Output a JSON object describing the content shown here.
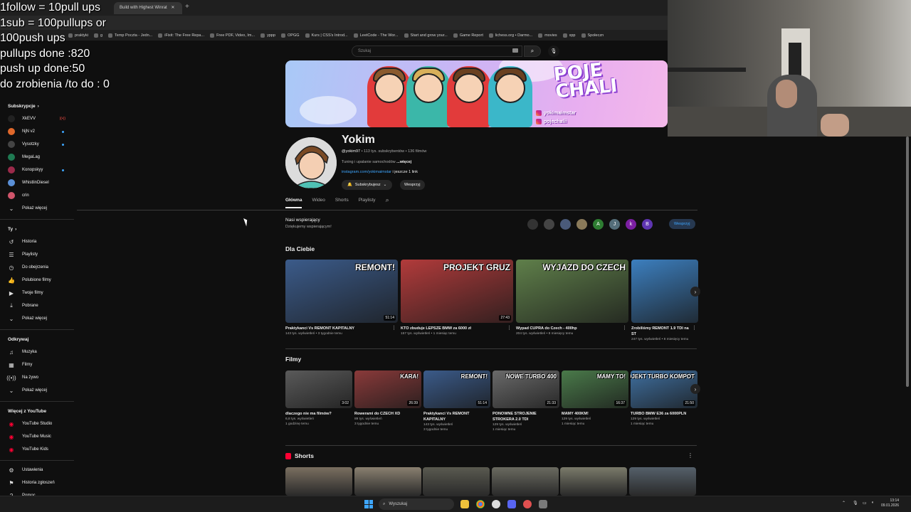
{
  "overlay": {
    "lines": [
      "1follow = 10pull ups",
      "1sub = 100pullups or",
      "100push ups",
      "pullups done :820",
      "push up done:50",
      "do zrobienia /to do : 0"
    ]
  },
  "browser": {
    "tabs": [
      "Build with Highest Winrat"
    ],
    "new_tab_glyph": "+",
    "bookmarks": [
      "praktyki",
      "g",
      "Temp Poczta - Jedn...",
      "iFixit: The Free Repa...",
      "Free PDF, Video, Im...",
      "yppp",
      "OPGG",
      "Kurs | CSS's Introd...",
      "LeetCode - The Wor...",
      "Start and grow your...",
      "Game Report",
      "lichess.org • Darmo...",
      "movies",
      "xpp",
      "Społeczn"
    ]
  },
  "header": {
    "search_placeholder": "Szukaj"
  },
  "sidebar": {
    "subs_title": "Subskrypcje",
    "subs": [
      {
        "label": "XkEVV",
        "color": "#222222",
        "badge": "live"
      },
      {
        "label": "NjN v2",
        "color": "#e0682b",
        "badge": "dot"
      },
      {
        "label": "Vysotzky",
        "color": "#444444",
        "badge": "dot"
      },
      {
        "label": "MegaLag",
        "color": "#1f7a52",
        "badge": ""
      },
      {
        "label": "Konopskyy",
        "color": "#9b2a4a",
        "badge": "dot"
      },
      {
        "label": "WhistlinDiesel",
        "color": "#5a8fd6",
        "badge": ""
      },
      {
        "label": "crin",
        "color": "#d0556b",
        "badge": ""
      }
    ],
    "show_more": "Pokaż więcej",
    "you_title": "Ty",
    "you_items": [
      {
        "label": "Historia",
        "icon": "history-icon",
        "glyph": "↺"
      },
      {
        "label": "Playlisty",
        "icon": "playlists-icon",
        "glyph": "☰"
      },
      {
        "label": "Do obejrzenia",
        "icon": "watch-later-icon",
        "glyph": "◷"
      },
      {
        "label": "Polubione filmy",
        "icon": "liked-icon",
        "glyph": "👍"
      },
      {
        "label": "Twoje filmy",
        "icon": "your-videos-icon",
        "glyph": "▶"
      },
      {
        "label": "Pobrane",
        "icon": "downloads-icon",
        "glyph": "⤓"
      },
      {
        "label": "Pokaż więcej",
        "icon": "chevron-down-icon",
        "glyph": "⌄"
      }
    ],
    "explore_title": "Odkrywaj",
    "explore_items": [
      {
        "label": "Muzyka",
        "icon": "music-icon",
        "glyph": "♫"
      },
      {
        "label": "Filmy",
        "icon": "movies-icon",
        "glyph": "▦"
      },
      {
        "label": "Na żywo",
        "icon": "live-icon",
        "glyph": "((•))"
      },
      {
        "label": "Pokaż więcej",
        "icon": "chevron-down-icon",
        "glyph": "⌄"
      }
    ],
    "more_title": "Więcej z YouTube",
    "more_items": [
      "YouTube Studio",
      "YouTube Music",
      "YouTube Kids"
    ],
    "bottom_items": [
      {
        "label": "Ustawienia",
        "icon": "settings-icon",
        "glyph": "⚙"
      },
      {
        "label": "Historia zgłoszeń",
        "icon": "flag-icon",
        "glyph": "⚑"
      },
      {
        "label": "Pomoc",
        "icon": "help-icon",
        "glyph": "?"
      }
    ]
  },
  "banner": {
    "logo": "POJE\nCHALI",
    "insta_1": "yokimaimstar",
    "insta_2": "pojechalii"
  },
  "channel": {
    "name": "Yokim",
    "handle": "@yokim97",
    "meta": " • 113 tys. subskrybentów • 136 filmów",
    "desc": "Tuning i upalanie samochodów ",
    "desc_more": "...więcej",
    "link": "instagram.com/yokimaimstar",
    "link_more": " i jeszcze 1 link",
    "subscribed_label": "Subskrybujesz",
    "join_label": "Wesprzyj",
    "tabs": [
      "Główna",
      "Wideo",
      "Shorts",
      "Playlisty"
    ]
  },
  "supporters": {
    "title": "Nasi wspierający",
    "subtitle": "Dziękujemy wspierającym!",
    "avatars": [
      {
        "letter": "",
        "color": "#333333"
      },
      {
        "letter": "",
        "color": "#444444"
      },
      {
        "letter": "",
        "color": "#4a5a7a"
      },
      {
        "letter": "",
        "color": "#8a7a5a"
      },
      {
        "letter": "A",
        "color": "#2e7d32"
      },
      {
        "letter": "J",
        "color": "#546e7a"
      },
      {
        "letter": "k",
        "color": "#7b1fa2"
      },
      {
        "letter": "B",
        "color": "#5e35b1"
      }
    ],
    "button": "Wesprzyj"
  },
  "for_you": {
    "title": "Dla Ciebie",
    "videos": [
      {
        "title": "Praktykanci Vs REMONT KAPITALNY",
        "meta": "143 tys. wyświetleń • 3 tygodnie temu",
        "duration": "51:14",
        "overlay": "REMONT!",
        "bg": "#3b5b8a"
      },
      {
        "title": "KTO zbuduje LEPSZE BMW za 6000 zł",
        "meta": "157 tys. wyświetleń • 1 miesiąc temu",
        "duration": "27:43",
        "overlay": "PROJEKT GRUZ",
        "bg": "#b23b3b"
      },
      {
        "title": "Wypad CUPRA do Czech - 400hp",
        "meta": "204 tys. wyświetleń • 8 miesięcy temu",
        "duration": "",
        "overlay": "WYJAZD DO CZECH",
        "bg": "#5f7f4a"
      },
      {
        "title": "Zrobiliśmy REMONT 1.9 TDI na ST",
        "meta": "247 tys. wyświetleń • 8 miesięcy temu",
        "duration": "",
        "overlay": "",
        "bg": "#3c7fbf"
      }
    ]
  },
  "films": {
    "title": "Filmy",
    "videos": [
      {
        "title": "dlaczego nie ma filmów?",
        "meta1": "6,8 tys. wyświetleń",
        "meta2": "1 godzinę temu",
        "duration": "3:02",
        "overlay": "",
        "bg": "#5a5a5a"
      },
      {
        "title": "Rowerami do CZECH XD",
        "meta1": "89 tys. wyświetleń",
        "meta2": "3 tygodnie temu",
        "duration": "26:39",
        "overlay": "KARA!",
        "bg": "#8a3a3a"
      },
      {
        "title": "Praktykanci Vs REMONT KAPITALNY",
        "meta1": "143 tys. wyświetleń",
        "meta2": "3 tygodnie temu",
        "duration": "51:14",
        "overlay": "REMONT!",
        "bg": "#3b5b8a"
      },
      {
        "title": "PONOWNE STROJENIE STROKERA 2.0 TDI",
        "meta1": "129 tys. wyświetleń",
        "meta2": "1 miesiąc temu",
        "duration": "21:33",
        "overlay": "NOWE TURBO 400",
        "bg": "#6a6a6a"
      },
      {
        "title": "MAMY 400KM!",
        "meta1": "129 tys. wyświetleń",
        "meta2": "1 miesiąc temu",
        "duration": "16:37",
        "overlay": "MAMY TO!",
        "bg": "#4a7a4a"
      },
      {
        "title": "TURBO BMW E36 za 6000PLN",
        "meta1": "129 tys. wyświetleń",
        "meta2": "1 miesiąc temu",
        "duration": "21:50",
        "overlay": "PROJEKT TURBO KOMPOT",
        "bg": "#3f6f9f"
      }
    ]
  },
  "shorts": {
    "title": "Shorts",
    "colors": [
      "#7a6f60",
      "#8a8070",
      "#5a5a50",
      "#6a6a60",
      "#7a7a6a",
      "#55606a"
    ]
  },
  "taskbar": {
    "search": "Wyszukaj",
    "time": "13:14",
    "date": "09.01.2026"
  }
}
